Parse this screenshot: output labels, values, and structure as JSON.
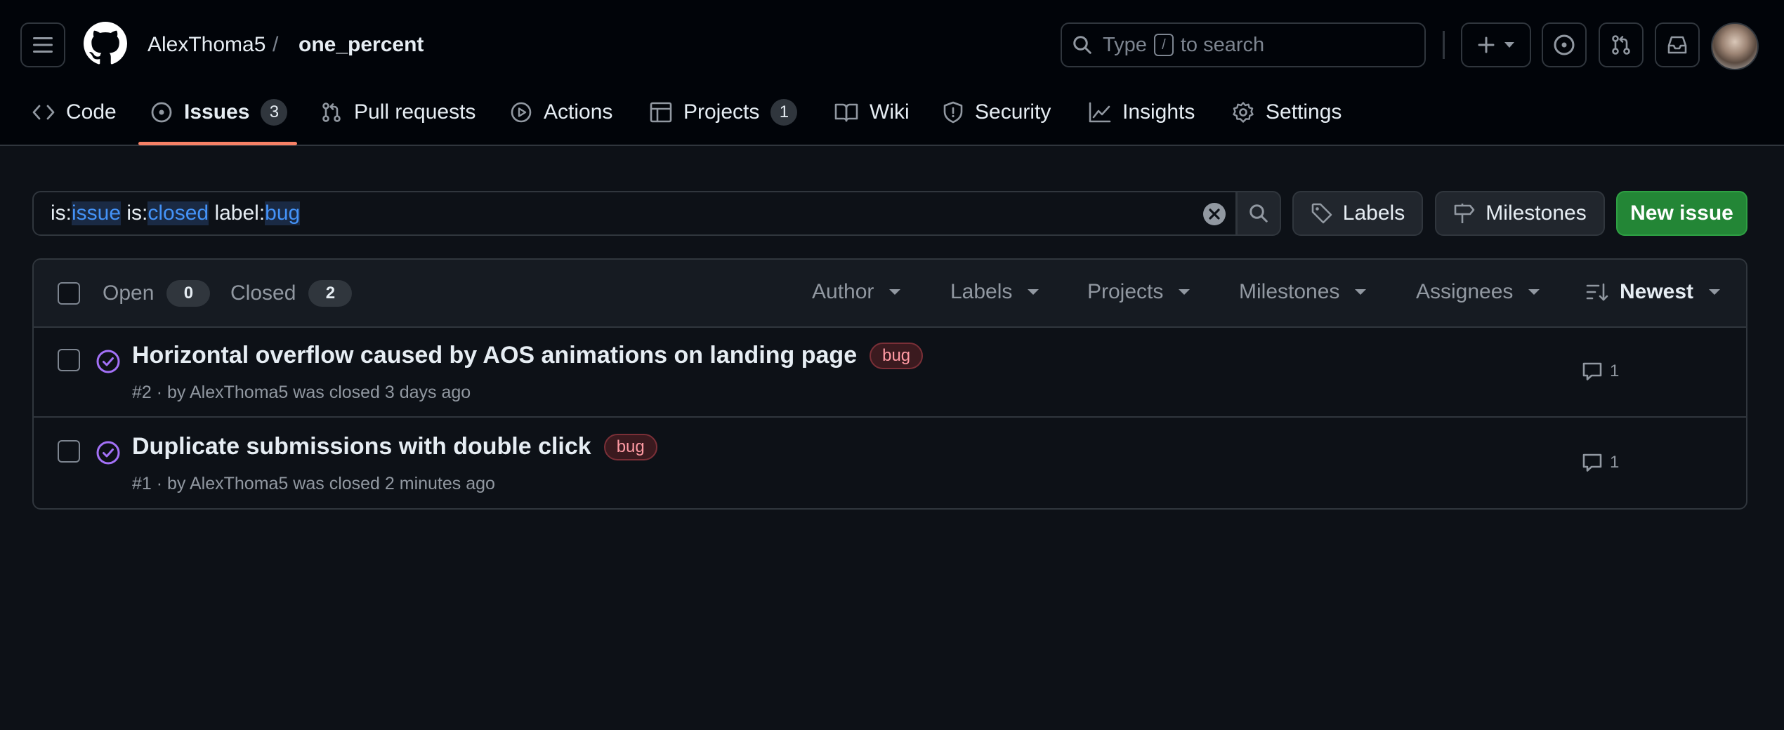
{
  "header": {
    "owner": "AlexThoma5",
    "separator": "/",
    "repo": "one_percent",
    "search": {
      "prefix": "Type",
      "key": "/",
      "suffix": "to search"
    }
  },
  "tabs": [
    {
      "label": "Code"
    },
    {
      "label": "Issues",
      "count": "3"
    },
    {
      "label": "Pull requests"
    },
    {
      "label": "Actions"
    },
    {
      "label": "Projects",
      "count": "1"
    },
    {
      "label": "Wiki"
    },
    {
      "label": "Security"
    },
    {
      "label": "Insights"
    },
    {
      "label": "Settings"
    }
  ],
  "filter": {
    "tokens": [
      {
        "key": "is:",
        "value": "issue"
      },
      {
        "key": "is:",
        "value": "closed"
      },
      {
        "key": "label:",
        "value": "bug"
      }
    ]
  },
  "buttons": {
    "labels": "Labels",
    "milestones": "Milestones",
    "new_issue": "New issue"
  },
  "list_header": {
    "open_label": "Open",
    "open_count": "0",
    "closed_label": "Closed",
    "closed_count": "2",
    "filters": [
      "Author",
      "Labels",
      "Projects",
      "Milestones",
      "Assignees"
    ],
    "sort": "Newest"
  },
  "issues": [
    {
      "title": "Horizontal overflow caused by AOS animations on landing page",
      "label": "bug",
      "meta": "#2 · by AlexThoma5 was closed 3 days ago",
      "comments": "1"
    },
    {
      "title": "Duplicate submissions with double click",
      "label": "bug",
      "meta": "#1 · by AlexThoma5 was closed 2 minutes ago",
      "comments": "1"
    }
  ],
  "colors": {
    "background": "#0d1117",
    "header": "#010409",
    "accent_underline": "#f78166",
    "closed_icon": "#a371f7",
    "new_issue": "#238636",
    "filter_value": "#4493f8"
  }
}
